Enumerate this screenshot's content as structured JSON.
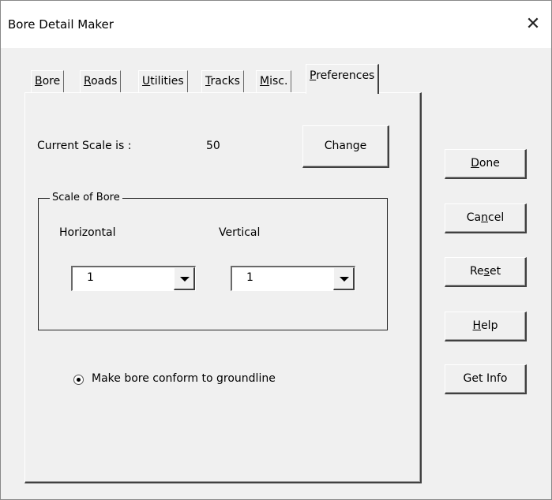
{
  "window": {
    "title": "Bore Detail Maker",
    "close_glyph": "✕"
  },
  "tabs": [
    {
      "pre": "",
      "key": "B",
      "post": "ore"
    },
    {
      "pre": "",
      "key": "R",
      "post": "oads"
    },
    {
      "pre": "",
      "key": "U",
      "post": "tilities"
    },
    {
      "pre": "",
      "key": "T",
      "post": "racks"
    },
    {
      "pre": "",
      "key": "M",
      "post": "isc."
    },
    {
      "pre": "",
      "key": "P",
      "post": "references"
    }
  ],
  "active_tab": "Preferences",
  "preferences": {
    "current_scale_label": "Current Scale is :",
    "current_scale_value": "50",
    "change_button": "Change",
    "scale_frame_title": "Scale of Bore",
    "horizontal_label": "Horizontal",
    "vertical_label": "Vertical",
    "horizontal_value": "1",
    "vertical_value": "1",
    "conform_label": "Make bore conform to groundline",
    "conform_checked": true
  },
  "side_buttons": {
    "done": {
      "pre": "",
      "key": "D",
      "post": "one"
    },
    "cancel": {
      "pre": "Ca",
      "key": "n",
      "post": "cel"
    },
    "reset": {
      "pre": "Re",
      "key": "s",
      "post": "et"
    },
    "help": {
      "pre": "",
      "key": "H",
      "post": "elp"
    },
    "get_info": "Get Info"
  }
}
